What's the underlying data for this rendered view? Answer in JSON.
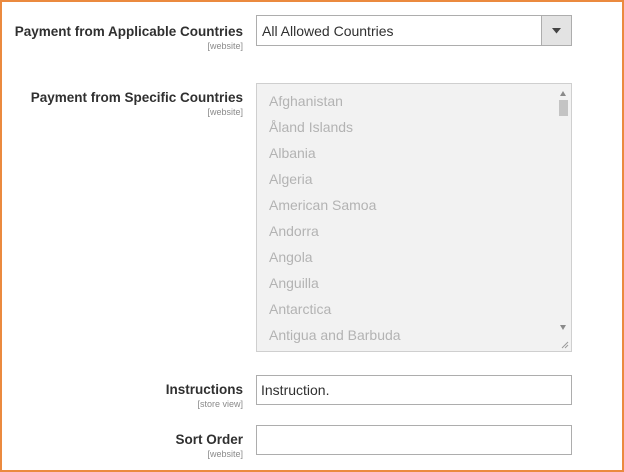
{
  "fields": {
    "applicable_countries": {
      "label": "Payment from Applicable Countries",
      "scope": "[website]",
      "selected_value": "All Allowed Countries"
    },
    "specific_countries": {
      "label": "Payment from Specific Countries",
      "scope": "[website]",
      "options": [
        "Afghanistan",
        "Åland Islands",
        "Albania",
        "Algeria",
        "American Samoa",
        "Andorra",
        "Angola",
        "Anguilla",
        "Antarctica",
        "Antigua and Barbuda"
      ]
    },
    "instructions": {
      "label": "Instructions",
      "scope": "[store view]",
      "value": "Instruction."
    },
    "sort_order": {
      "label": "Sort Order",
      "scope": "[website]",
      "value": ""
    }
  },
  "icons": {
    "select_arrow": "chevron-down-icon",
    "scroll_up": "scroll-up-arrow-icon",
    "scroll_down": "scroll-down-arrow-icon",
    "resize": "resize-grip-icon"
  },
  "colors": {
    "frame_border": "#eb8a3f",
    "label_text": "#303030",
    "scope_text": "#8a8a8a",
    "disabled_option_text": "#b3b3b3",
    "disabled_background": "#f2f2f2",
    "input_border": "#adadad"
  }
}
